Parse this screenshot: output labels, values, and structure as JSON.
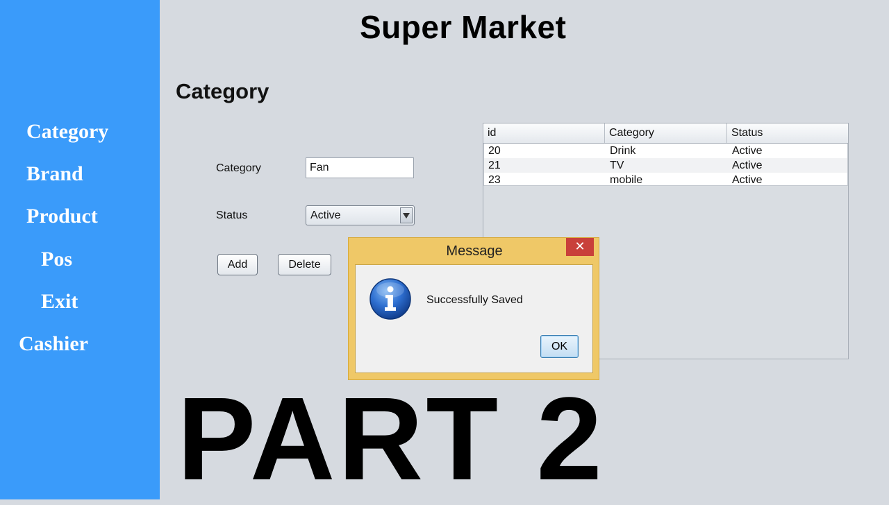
{
  "app": {
    "title": "Super Market"
  },
  "sidebar": {
    "items": [
      {
        "label": "Category"
      },
      {
        "label": "Brand"
      },
      {
        "label": "Product"
      },
      {
        "label": "Pos"
      },
      {
        "label": "Exit"
      },
      {
        "label": "Cashier"
      }
    ]
  },
  "form": {
    "section_title": "Category",
    "category_label": "Category",
    "category_value": "Fan",
    "status_label": "Status",
    "status_value": "Active",
    "add_label": "Add",
    "delete_label": "Delete"
  },
  "table": {
    "columns": [
      "id",
      "Category",
      "Status"
    ],
    "rows": [
      [
        "20",
        "Drink",
        "Active"
      ],
      [
        "21",
        "TV",
        "Active"
      ],
      [
        "23",
        "mobile",
        "Active"
      ]
    ]
  },
  "dialog": {
    "title": "Message",
    "close_glyph": "✕",
    "message": "Successfully Saved",
    "ok_label": "OK",
    "icon": "info-icon"
  },
  "overlay": {
    "text": "PART 2"
  },
  "colors": {
    "sidebar": "#3a9bfa",
    "background": "#d6dae0",
    "dialog_frame": "#efc867",
    "close_button": "#c9403a"
  }
}
